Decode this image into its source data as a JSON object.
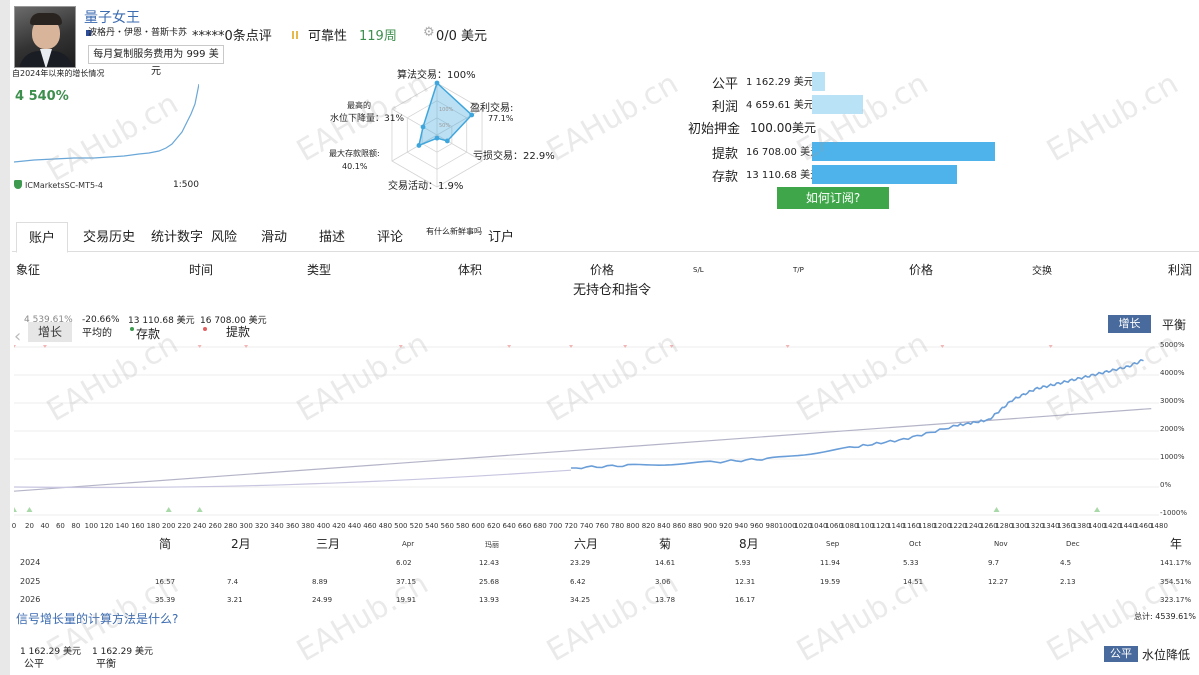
{
  "header": {
    "signal_name": "量子女王",
    "provider_name": "波格丹・伊恩・普斯卡苏",
    "rating": "*****0条点评",
    "reliability_label": "可靠性",
    "weeks": "119周",
    "price": "0/0 美元",
    "monthly_fee": "每月复制服务费用为 999 美元"
  },
  "growth_summary": {
    "label": "自2024年以来的增长情况",
    "value": "4 540%",
    "broker": "ICMarketsSC-MT5-4",
    "leverage": "1:500"
  },
  "radar": {
    "algo_trading": "算法交易：100%",
    "profit_trades_label": "盈利交易:",
    "profit_trades_value": "77.1%",
    "loss_trades": "亏损交易：22.9%",
    "trading_activity": "交易活动：1.9%",
    "max_deposit_label": "最大存款限额:",
    "max_deposit_value": "40.1%",
    "max_drawdown_label1": "最高的",
    "max_drawdown_label2": "水位下降量：31%",
    "ring_labels": [
      "100%",
      "50%"
    ],
    "values": {
      "algo": 1.0,
      "profit": 0.771,
      "loss": 0.229,
      "activity": 0.019,
      "deposit_load": 0.401,
      "drawdown": 0.31
    },
    "accent_color": "#3ea6dc"
  },
  "finances": [
    {
      "label": "公平",
      "value": "1 162.29 美元",
      "bar_fraction": 0.07,
      "color": "#b9e2f7"
    },
    {
      "label": "利润",
      "value": "4 659.61 美元",
      "bar_fraction": 0.28,
      "color": "#b9e2f7"
    },
    {
      "label": "初始押金",
      "value": "100.00美元",
      "bar_fraction": 0,
      "color": "#b9e2f7"
    },
    {
      "label": "提款",
      "value": "16 708.00 美元",
      "bar_fraction": 1.0,
      "color": "#4db3ea"
    },
    {
      "label": "存款",
      "value": "13 110.68 美元",
      "bar_fraction": 0.79,
      "color": "#4db3ea"
    }
  ],
  "subscribe_button": "如何订阅?",
  "tabs": [
    "账户",
    "交易历史",
    "统计数字",
    "风险",
    "滑动",
    "描述",
    "评论",
    "有什么新鲜事吗",
    "订户"
  ],
  "table_headers": {
    "symbol": "象征",
    "time": "时间",
    "type": "类型",
    "volume": "体积",
    "price": "价格",
    "sl": "S/L",
    "tp": "T/P",
    "price2": "价格",
    "swap": "交换",
    "profit": "利润"
  },
  "no_positions": "无持仓和指令",
  "chart": {
    "legend": [
      {
        "value": "4 539.61%",
        "name": "增长"
      },
      {
        "value": "-20.66%",
        "name": "平均的"
      },
      {
        "value": "13 110.68 美元",
        "name": "存款"
      },
      {
        "value": "16 708.00 美元",
        "name": "提款"
      }
    ],
    "growth_button": "增长",
    "balance_label": "平衡",
    "y_ticks": [
      "5000%",
      "4000%",
      "3000%",
      "2000%",
      "1000%",
      "0%",
      "-1000%"
    ],
    "x_ticks": [
      "0",
      "20",
      "40",
      "60",
      "80",
      "100",
      "120",
      "140",
      "160",
      "180",
      "200",
      "220",
      "240",
      "260",
      "280",
      "300",
      "320",
      "340",
      "360",
      "380",
      "400",
      "420",
      "440",
      "460",
      "480",
      "500",
      "520",
      "540",
      "560",
      "580",
      "600",
      "620",
      "640",
      "660",
      "680",
      "700",
      "720",
      "740",
      "760",
      "780",
      "800",
      "820",
      "840",
      "860",
      "880",
      "900",
      "920",
      "940",
      "960",
      "980",
      "1000",
      "1020",
      "1040",
      "1060",
      "1080",
      "1100",
      "1120",
      "1140",
      "1160",
      "1180",
      "1200",
      "1220",
      "1240",
      "1260",
      "1280",
      "1300",
      "1320",
      "1340",
      "1360",
      "1380",
      "1400",
      "1420",
      "1440",
      "1460",
      "1480"
    ],
    "growth_color": "#6a9ed8",
    "trend_color": "#b0b0c8"
  },
  "chart_data": {
    "type": "line",
    "x": [
      720,
      800,
      900,
      980,
      1080,
      1150,
      1220,
      1260,
      1290,
      1320,
      1350,
      1380,
      1410,
      1440,
      1460
    ],
    "series": [
      {
        "name": "增长",
        "values": [
          680,
          780,
          880,
          1020,
          1400,
          1700,
          2200,
          2400,
          3100,
          3500,
          3700,
          3900,
          4100,
          4300,
          4539.61
        ]
      }
    ],
    "ylim": [
      -1000,
      5000
    ]
  },
  "monthly": {
    "months": [
      "简",
      "2月",
      "三月",
      "Apr",
      "玛丽",
      "六月",
      "菊",
      "8月",
      "Sep",
      "Oct",
      "Nov",
      "Dec",
      "年"
    ],
    "rows": [
      {
        "year": "2024",
        "cells": [
          "",
          "",
          "",
          "6.02",
          "12.43",
          "23.29",
          "14.61",
          "5.93",
          "11.94",
          "5.33",
          "9.7",
          "4.5",
          "141.17%"
        ]
      },
      {
        "year": "2025",
        "cells": [
          "16.57",
          "7.4",
          "8.89",
          "37.15",
          "25.68",
          "6.42",
          "3.06",
          "12.31",
          "19.59",
          "14.51",
          "12.27",
          "2.13",
          "354.51%"
        ]
      },
      {
        "year": "2026",
        "cells": [
          "35.39",
          "3.21",
          "24.99",
          "19.91",
          "13.93",
          "34.25",
          "13.78",
          "16.17",
          "",
          "",
          "",
          "",
          "323.17%"
        ]
      }
    ]
  },
  "question": "信号增长量的计算方法是什么?",
  "total": "总计: 4539.61%",
  "footer": {
    "equity_value": "1 162.29 美元",
    "equity_name": "公平",
    "balance_value": "1 162.29 美元",
    "balance_name": "平衡",
    "fair_button": "公平",
    "drawdown_label": "水位降低"
  },
  "watermark": "EAHub.cn"
}
